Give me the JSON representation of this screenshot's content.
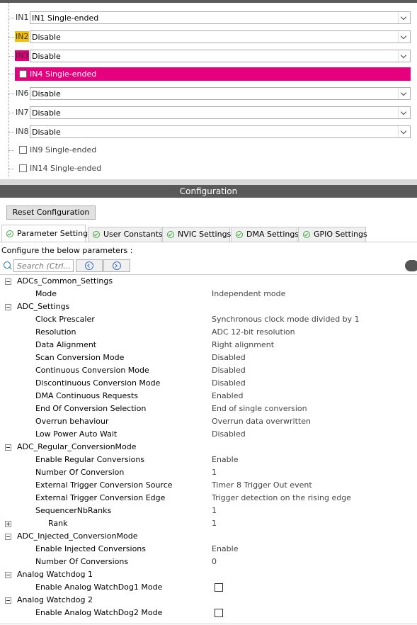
{
  "channels": [
    {
      "label": "IN1",
      "value": "IN1 Single-ended"
    },
    {
      "label": "IN2",
      "value": "Disable"
    },
    {
      "label": "IN3",
      "value": "Disable"
    },
    {
      "label": "IN4 Single-ended"
    },
    {
      "label": "IN6",
      "value": "Disable"
    },
    {
      "label": "IN7",
      "value": "Disable"
    },
    {
      "label": "IN8",
      "value": "Disable"
    },
    {
      "label": "IN9 Single-ended"
    },
    {
      "label": "IN14 Single-ended"
    }
  ],
  "config": {
    "title": "Configuration",
    "reset_label": "Reset Configuration",
    "tabs": [
      {
        "label": "Parameter Settings"
      },
      {
        "label": "User Constants"
      },
      {
        "label": "NVIC Settings"
      },
      {
        "label": "DMA Settings"
      },
      {
        "label": "GPIO Settings"
      }
    ],
    "instructions": "Configure the below parameters :",
    "search_placeholder": "Search (Ctrl..."
  },
  "params": [
    {
      "name": "ADCs_Common_Settings"
    },
    {
      "name": "Mode",
      "value": "Independent mode"
    },
    {
      "name": "ADC_Settings"
    },
    {
      "name": "Clock Prescaler",
      "value": "Synchronous clock mode divided by 1"
    },
    {
      "name": "Resolution",
      "value": "ADC 12-bit resolution"
    },
    {
      "name": "Data Alignment",
      "value": "Right alignment"
    },
    {
      "name": "Scan Conversion Mode",
      "value": "Disabled"
    },
    {
      "name": "Continuous Conversion Mode",
      "value": "Disabled"
    },
    {
      "name": "Discontinuous Conversion Mode",
      "value": "Disabled"
    },
    {
      "name": "DMA Continuous Requests",
      "value": "Enabled"
    },
    {
      "name": "End Of Conversion Selection",
      "value": "End of single conversion"
    },
    {
      "name": "Overrun behaviour",
      "value": "Overrun data overwritten"
    },
    {
      "name": "Low Power Auto Wait",
      "value": "Disabled"
    },
    {
      "name": "ADC_Regular_ConversionMode"
    },
    {
      "name": "Enable Regular Conversions",
      "value": "Enable"
    },
    {
      "name": "Number Of Conversion",
      "value": "1"
    },
    {
      "name": "External Trigger Conversion Source",
      "value": "Timer 8 Trigger Out event"
    },
    {
      "name": "External Trigger Conversion Edge",
      "value": "Trigger detection on the rising edge"
    },
    {
      "name": "SequencerNbRanks",
      "value": "1"
    },
    {
      "name": "Rank",
      "value": "1"
    },
    {
      "name": "ADC_Injected_ConversionMode"
    },
    {
      "name": "Enable Injected Conversions",
      "value": "Enable"
    },
    {
      "name": "Number Of Conversions",
      "value": "0"
    },
    {
      "name": "Analog Watchdog 1"
    },
    {
      "name": "Enable Analog WatchDog1 Mode"
    },
    {
      "name": "Analog Watchdog 2"
    },
    {
      "name": "Enable Analog WatchDog2 Mode"
    }
  ],
  "colors": {
    "highlight_yellow": "#f6c000",
    "highlight_magenta": "#e6007e",
    "header_bg": "#595959"
  }
}
